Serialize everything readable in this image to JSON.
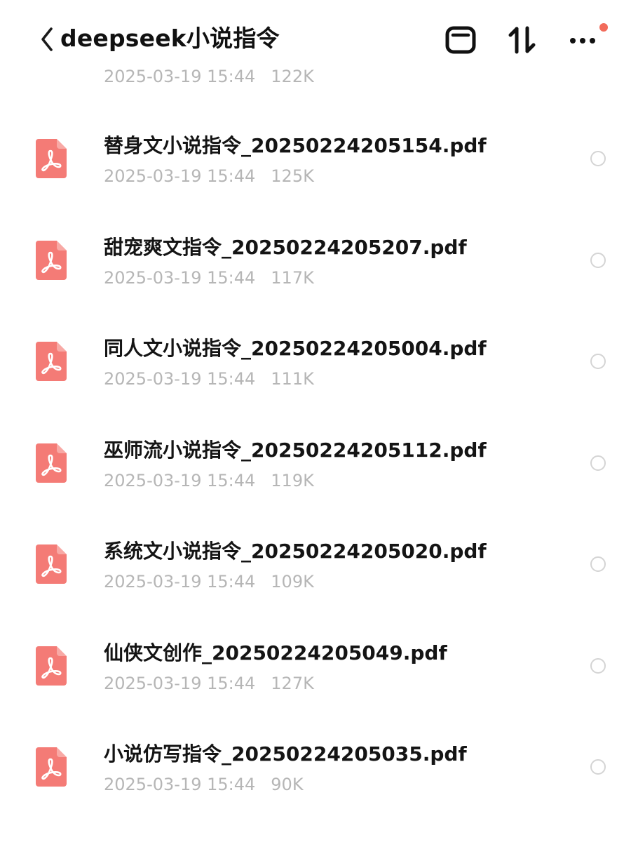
{
  "header": {
    "title": "deepseek小说指令",
    "back_icon": "chevron-left-icon",
    "window_icon": "window-icon",
    "sort_icon": "sort-arrows-icon",
    "more_icon": "more-dots-icon",
    "notification_dot_color": "#f26b5b"
  },
  "colors": {
    "pdf_icon": "#f47b76",
    "text_primary": "#141414",
    "text_secondary": "#b6b6b6",
    "radio_border": "#d4d4d4"
  },
  "partial_item": {
    "date": "2025-03-19 15:44",
    "size": "122K"
  },
  "files": [
    {
      "name": "替身文小说指令_20250224205154.pdf",
      "date": "2025-03-19 15:44",
      "size": "125K",
      "icon": "pdf-file-icon",
      "selected": false
    },
    {
      "name": "甜宠爽文指令_20250224205207.pdf",
      "date": "2025-03-19 15:44",
      "size": "117K",
      "icon": "pdf-file-icon",
      "selected": false
    },
    {
      "name": "同人文小说指令_20250224205004.pdf",
      "date": "2025-03-19 15:44",
      "size": "111K",
      "icon": "pdf-file-icon",
      "selected": false
    },
    {
      "name": "巫师流小说指令_20250224205112.pdf",
      "date": "2025-03-19 15:44",
      "size": "119K",
      "icon": "pdf-file-icon",
      "selected": false
    },
    {
      "name": "系统文小说指令_20250224205020.pdf",
      "date": "2025-03-19 15:44",
      "size": "109K",
      "icon": "pdf-file-icon",
      "selected": false
    },
    {
      "name": "仙侠文创作_20250224205049.pdf",
      "date": "2025-03-19 15:44",
      "size": "127K",
      "icon": "pdf-file-icon",
      "selected": false
    },
    {
      "name": "小说仿写指令_20250224205035.pdf",
      "date": "2025-03-19 15:44",
      "size": "90K",
      "icon": "pdf-file-icon",
      "selected": false
    }
  ]
}
